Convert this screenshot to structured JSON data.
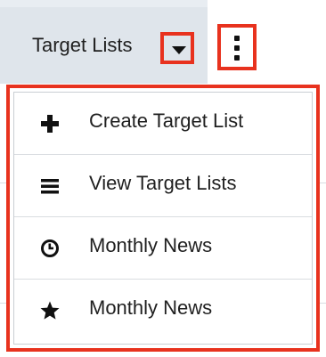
{
  "nav": {
    "tab_label": "Target Lists"
  },
  "menu": {
    "items": [
      {
        "label": "Create Target List",
        "icon": "plus-icon"
      },
      {
        "label": "View Target Lists",
        "icon": "list-icon"
      },
      {
        "label": "Monthly News",
        "icon": "clock-icon"
      },
      {
        "label": "Monthly News",
        "icon": "star-icon"
      }
    ]
  },
  "colors": {
    "highlight": "#e8321e",
    "tab_background": "#dfe5eb"
  }
}
